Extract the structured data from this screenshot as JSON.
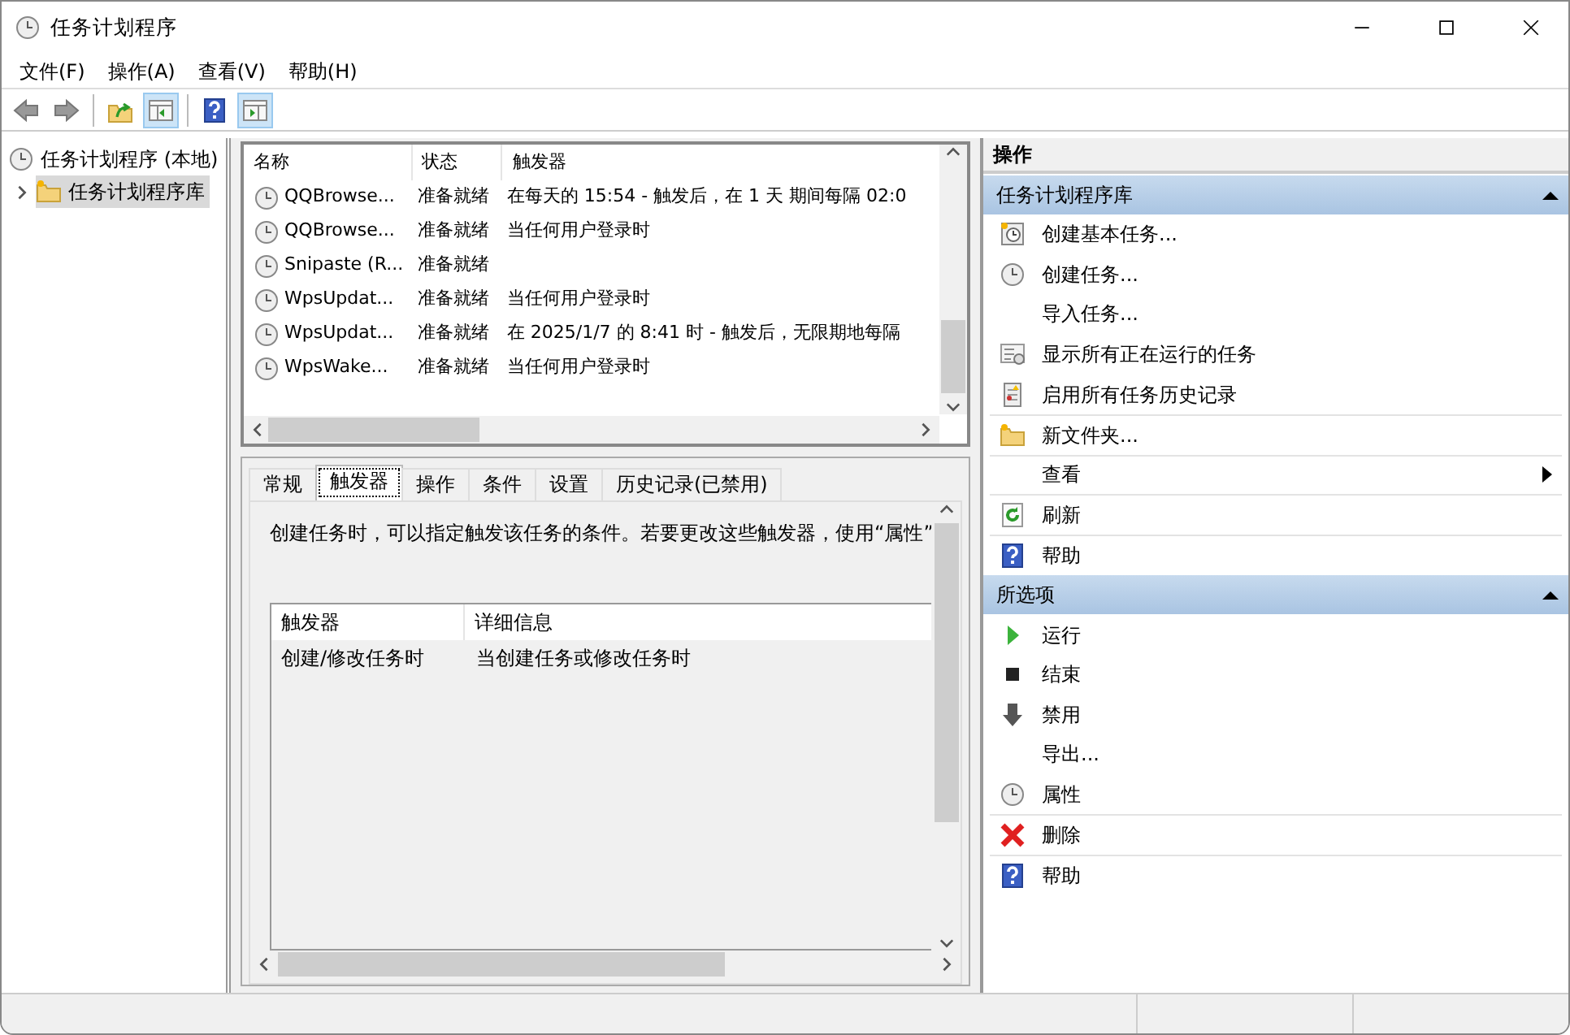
{
  "window": {
    "title": "任务计划程序"
  },
  "menu": [
    {
      "label": "文件(F)"
    },
    {
      "label": "操作(A)"
    },
    {
      "label": "查看(V)"
    },
    {
      "label": "帮助(H)"
    }
  ],
  "toolbar": [
    {
      "pressed": false
    },
    {
      "pressed": false
    },
    {
      "pressed": false
    },
    {
      "pressed": true
    },
    {
      "pressed": false
    },
    {
      "pressed": true
    }
  ],
  "tree": {
    "label": "任务计划程序 (本地)",
    "children": [
      {
        "label": "任务计划程序库",
        "selected": true,
        "expanded": false
      }
    ]
  },
  "tasks": {
    "columns": [
      "名称",
      "状态",
      "触发器"
    ],
    "rows": [
      {
        "name": "QQBrowse...",
        "status": "准备就绪",
        "trigger": "在每天的 15:54 - 触发后，在 1 天 期间每隔 02:0"
      },
      {
        "name": "QQBrowse...",
        "status": "准备就绪",
        "trigger": "当任何用户登录时"
      },
      {
        "name": "Snipaste (R...",
        "status": "准备就绪"
      },
      {
        "name": "WpsUpdat...",
        "status": "准备就绪",
        "trigger": "当任何用户登录时"
      },
      {
        "name": "WpsUpdat...",
        "status": "准备就绪",
        "trigger": "在 2025/1/7 的 8:41 时 - 触发后，无限期地每隔"
      },
      {
        "name": "WpsWake...",
        "status": "准备就绪",
        "trigger": "当任何用户登录时"
      }
    ]
  },
  "tabs": [
    {
      "label": "常规",
      "selected": false
    },
    {
      "label": "触发器",
      "selected": true
    },
    {
      "label": "操作",
      "selected": false
    },
    {
      "label": "条件",
      "selected": false
    },
    {
      "label": "设置",
      "selected": false
    },
    {
      "label": "历史记录(已禁用)",
      "selected": false
    }
  ],
  "trigger_tab": {
    "description": "创建任务时，可以指定触发该任务的条件。若要更改这些触发器，使用“属性”",
    "columns": [
      "触发器",
      "详细信息"
    ],
    "rows": [
      {
        "trigger": "创建/修改任务时",
        "details": "当创建任务或修改任务时"
      }
    ]
  },
  "actions": {
    "title": "操作",
    "sections": [
      {
        "title": "任务计划程序库",
        "expanded": true,
        "items": [
          {
            "label": "创建基本任务...",
            "kind": "wizard",
            "divider_above": false,
            "submenu": false
          },
          {
            "label": "创建任务...",
            "kind": "clock",
            "divider_above": false,
            "submenu": false
          },
          {
            "label": "导入任务...",
            "divider_above": false,
            "submenu": false
          },
          {
            "label": "显示所有正在运行的任务",
            "kind": "list",
            "divider_above": false,
            "submenu": false
          },
          {
            "label": "启用所有任务历史记录",
            "kind": "log",
            "divider_above": false,
            "submenu": false
          },
          {
            "label": "新文件夹...",
            "kind": "folder",
            "divider_above": true,
            "submenu": false
          },
          {
            "label": "查看",
            "divider_above": true,
            "submenu": true
          },
          {
            "label": "刷新",
            "kind": "refresh",
            "divider_above": true,
            "submenu": false
          },
          {
            "label": "帮助",
            "kind": "help",
            "divider_above": true,
            "submenu": false
          }
        ]
      },
      {
        "title": "所选项",
        "expanded": true,
        "items": [
          {
            "label": "运行",
            "kind": "run",
            "divider_above": false,
            "submenu": false
          },
          {
            "label": "结束",
            "kind": "stop",
            "divider_above": false,
            "submenu": false
          },
          {
            "label": "禁用",
            "kind": "down",
            "divider_above": false,
            "submenu": false
          },
          {
            "label": "导出...",
            "divider_above": false,
            "submenu": false
          },
          {
            "label": "属性",
            "kind": "clock",
            "divider_above": false,
            "submenu": false
          },
          {
            "label": "删除",
            "kind": "delete",
            "divider_above": true,
            "submenu": false
          },
          {
            "label": "帮助",
            "kind": "help",
            "divider_above": true,
            "submenu": false
          }
        ]
      }
    ]
  }
}
